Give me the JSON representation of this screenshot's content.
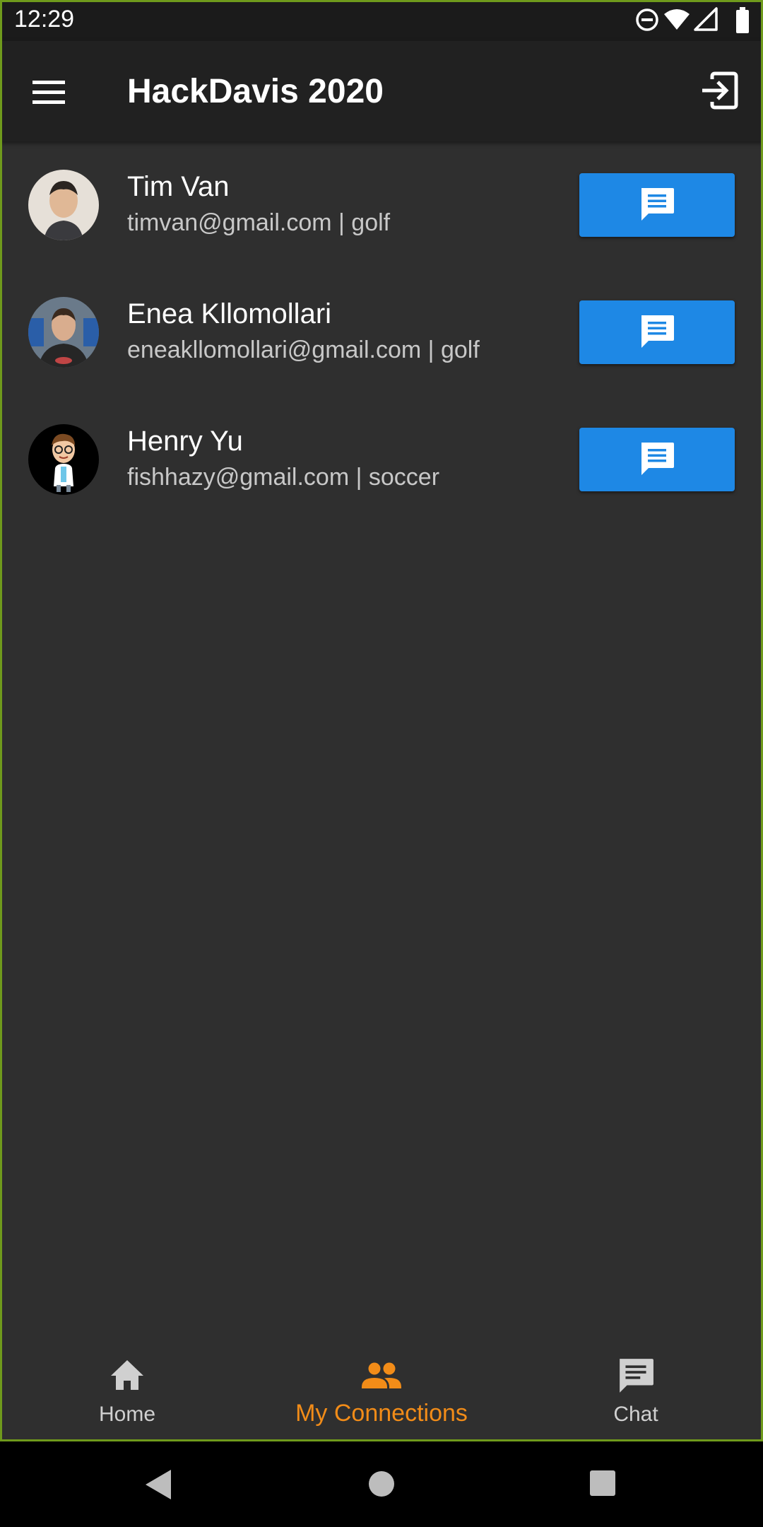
{
  "status_bar": {
    "time": "12:29",
    "icons": [
      "do-not-disturb-icon",
      "wifi-icon",
      "cell-signal-icon",
      "battery-icon"
    ]
  },
  "app_bar": {
    "title": "HackDavis 2020",
    "menu_icon": "menu-icon",
    "logout_icon": "logout-icon"
  },
  "connections": [
    {
      "name": "Tim Van",
      "subtitle": "timvan@gmail.com | golf",
      "action_icon": "message-icon"
    },
    {
      "name": "Enea Kllomollari",
      "subtitle": "eneakllomollari@gmail.com | golf",
      "action_icon": "message-icon"
    },
    {
      "name": "Henry Yu",
      "subtitle": "fishhazy@gmail.com | soccer",
      "action_icon": "message-icon"
    }
  ],
  "bottom_nav": {
    "items": [
      {
        "label": "Home",
        "icon": "home-icon",
        "active": false
      },
      {
        "label": "My Connections",
        "icon": "people-icon",
        "active": true
      },
      {
        "label": "Chat",
        "icon": "chat-icon",
        "active": false
      }
    ]
  },
  "colors": {
    "background": "#2f2f2f",
    "app_bar": "#212121",
    "status_bar": "#1b1b1b",
    "button": "#1e88e5",
    "active_nav": "#f28c18",
    "inactive_nav": "#d0d0d0"
  }
}
